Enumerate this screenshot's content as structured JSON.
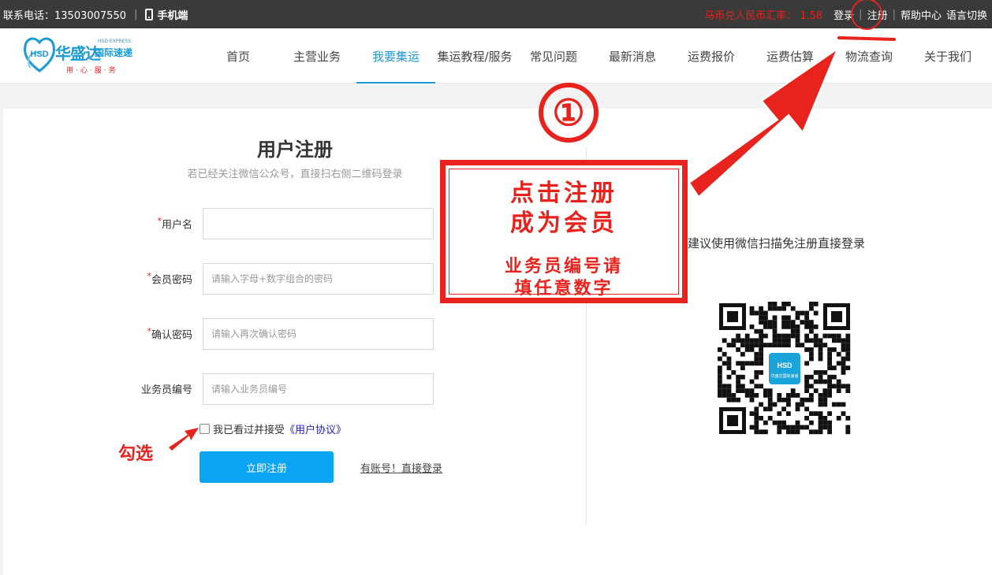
{
  "topbar": {
    "phone_label": "联系电话：13503007550",
    "mobile_label": "手机端",
    "rate_label": "马币兑人民币汇率：",
    "rate_value": "1.58",
    "login": "登录",
    "register": "注册",
    "help": "帮助中心",
    "language": "语言切换"
  },
  "logo": {
    "cn_name": "华盛达",
    "cn_small": "国际速递",
    "en_name": "HSD EXPRESS",
    "badge": "HSD",
    "slogan": "用·心·服·务"
  },
  "nav": {
    "items": [
      {
        "label": "首页"
      },
      {
        "label": "主营业务"
      },
      {
        "label": "我要集运"
      },
      {
        "label": "集运教程/服务"
      },
      {
        "label": "常见问题"
      },
      {
        "label": "最新消息"
      },
      {
        "label": "运费报价"
      },
      {
        "label": "运费估算"
      },
      {
        "label": "物流查询"
      },
      {
        "label": "关于我们"
      }
    ],
    "active_index": 2
  },
  "form": {
    "title": "用户注册",
    "subtitle": "若已经关注微信公众号，直接扫右侧二维码登录",
    "required_mark": "*",
    "username_label": "用户名",
    "username_value": "",
    "password_label": "会员密码",
    "password_placeholder": "请输入字母+数字组合的密码",
    "confirm_label": "确认密码",
    "confirm_placeholder": "请输入再次确认密码",
    "agent_label": "业务员编号",
    "agent_placeholder": "请输入业务员编号",
    "agree_text": "我已看过并接受",
    "agree_link": "《用户协议》",
    "submit": "立即注册",
    "login_link": "有账号！直接登录"
  },
  "side": {
    "wechat_tip": "建议使用微信扫描免注册直接登录",
    "qr_center_text": "华盛达国际速递"
  },
  "annotations": {
    "step_number": "①",
    "box_line1": "点击注册",
    "box_line2": "成为会员",
    "box_line3": "业务员编号请",
    "box_line4": "填任意数字",
    "check_hint": "勾选"
  },
  "colors": {
    "topbar_bg": "#3a3a3a",
    "accent": "#1a9bd7",
    "button": "#0aa5f3",
    "annotation": "#e8221c",
    "link": "#1f1fcf"
  }
}
